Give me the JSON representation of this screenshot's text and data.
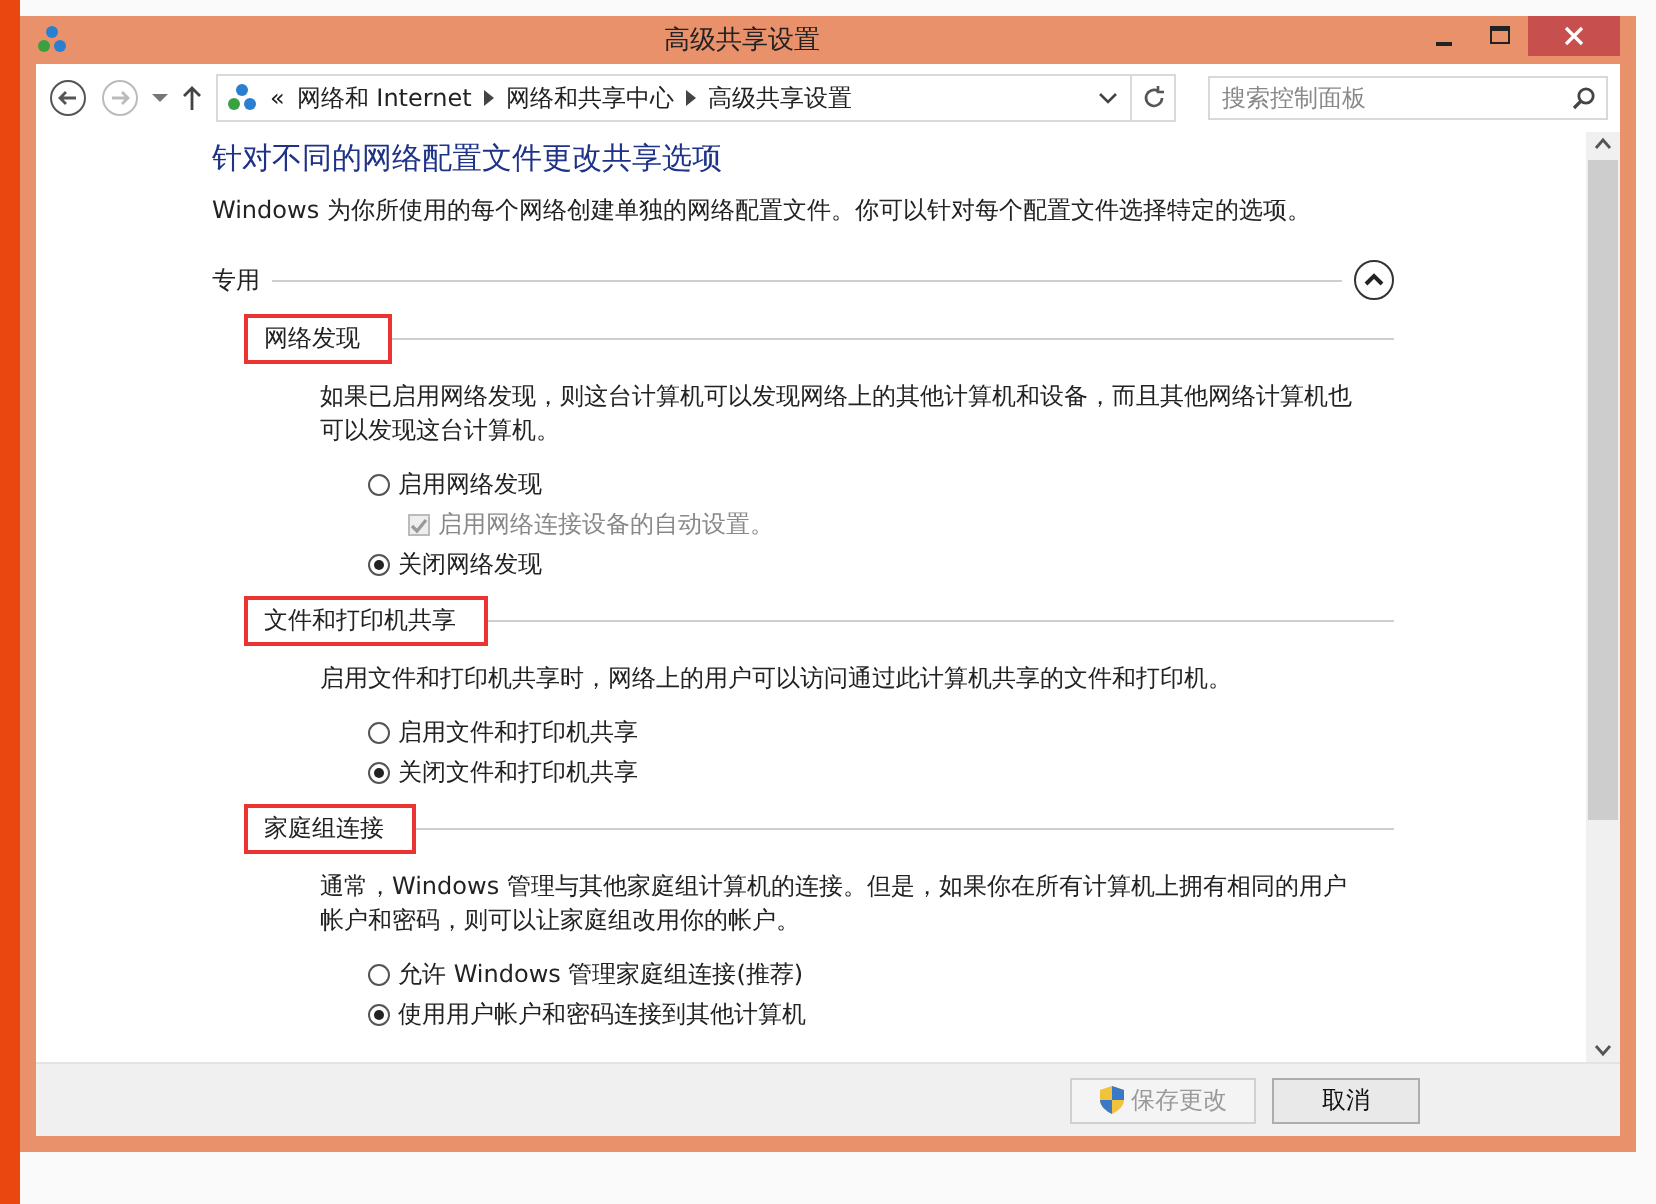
{
  "window": {
    "title": "高级共享设置"
  },
  "nav": {
    "overflow": "«",
    "breadcrumb": [
      "网络和 Internet",
      "网络和共享中心",
      "高级共享设置"
    ],
    "search": {
      "placeholder": "搜索控制面板"
    }
  },
  "heading": "针对不同的网络配置文件更改共享选项",
  "intro": "Windows 为你所使用的每个网络创建单独的网络配置文件。你可以针对每个配置文件选择特定的选项。",
  "profile": {
    "label": "专用",
    "expanded": true,
    "sections": [
      {
        "title": "网络发现",
        "highlighted": true,
        "description": "如果已启用网络发现，则这台计算机可以发现网络上的其他计算机和设备，而且其他网络计算机也可以发现这台计算机。",
        "options": [
          {
            "kind": "radio",
            "label": "启用网络发现",
            "selected": false
          },
          {
            "kind": "checkbox",
            "label": "启用网络连接设备的自动设置。",
            "checked": true,
            "disabled": true
          },
          {
            "kind": "radio",
            "label": "关闭网络发现",
            "selected": true
          }
        ]
      },
      {
        "title": "文件和打印机共享",
        "highlighted": true,
        "description": "启用文件和打印机共享时，网络上的用户可以访问通过此计算机共享的文件和打印机。",
        "options": [
          {
            "kind": "radio",
            "label": "启用文件和打印机共享",
            "selected": false
          },
          {
            "kind": "radio",
            "label": "关闭文件和打印机共享",
            "selected": true
          }
        ]
      },
      {
        "title": "家庭组连接",
        "highlighted": true,
        "description": "通常，Windows 管理与其他家庭组计算机的连接。但是，如果你在所有计算机上拥有相同的用户帐户和密码，则可以让家庭组改用你的帐户。",
        "options": [
          {
            "kind": "radio",
            "label": "允许 Windows 管理家庭组连接(推荐)",
            "selected": false
          },
          {
            "kind": "radio",
            "label": "使用用户帐户和密码连接到其他计算机",
            "selected": true
          }
        ]
      }
    ]
  },
  "buttons": [
    {
      "label": "保存更改",
      "disabled": true,
      "elevated": true
    },
    {
      "label": "取消",
      "disabled": false,
      "elevated": false
    }
  ]
}
